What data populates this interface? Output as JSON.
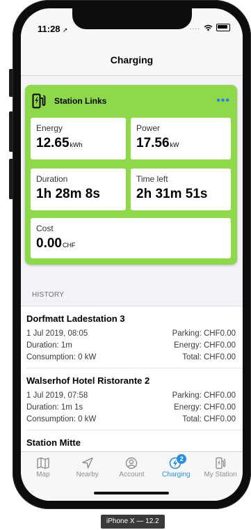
{
  "status_bar": {
    "time": "11:28",
    "signal_dots": "....",
    "location_arrow": "➚"
  },
  "nav": {
    "title": "Charging"
  },
  "station": {
    "name": "Station Links",
    "tiles": {
      "energy": {
        "label": "Energy",
        "value": "12.65",
        "unit": "kWh"
      },
      "power": {
        "label": "Power",
        "value": "17.56",
        "unit": "kW"
      },
      "duration": {
        "label": "Duration",
        "value": "1h 28m 8s"
      },
      "time_left": {
        "label": "Time left",
        "value": "2h 31m 51s"
      },
      "cost": {
        "label": "Cost",
        "value": "0.00",
        "unit": "CHF"
      }
    }
  },
  "history": {
    "label": "HISTORY",
    "items": [
      {
        "name": "Dorfmatt Ladestation 3",
        "date": "1 Jul 2019, 08:05",
        "duration": "Duration: 1m",
        "consumption": "Consumption: 0 kW",
        "parking": "Parking: CHF0.00",
        "energy": "Energy: CHF0.00",
        "total": "Total: CHF0.00"
      },
      {
        "name": "Walserhof Hotel Ristorante 2",
        "date": "1 Jul 2019, 07:58",
        "duration": "Duration: 1m 1s",
        "consumption": "Consumption: 0 kW",
        "parking": "Parking: CHF0.00",
        "energy": "Energy: CHF0.00",
        "total": "Total: CHF0.00"
      },
      {
        "name": "Station Mitte"
      }
    ]
  },
  "tabs": [
    {
      "label": "Map",
      "icon": "map-icon"
    },
    {
      "label": "Nearby",
      "icon": "location-arrow-icon"
    },
    {
      "label": "Account",
      "icon": "account-icon"
    },
    {
      "label": "Charging",
      "icon": "charging-icon",
      "badge": "2",
      "active": true
    },
    {
      "label": "My Station",
      "icon": "station-icon"
    }
  ],
  "device_caption": "iPhone X — 12.2",
  "colors": {
    "card_green": "#8ed94a",
    "accent_blue": "#2b8fe0"
  }
}
